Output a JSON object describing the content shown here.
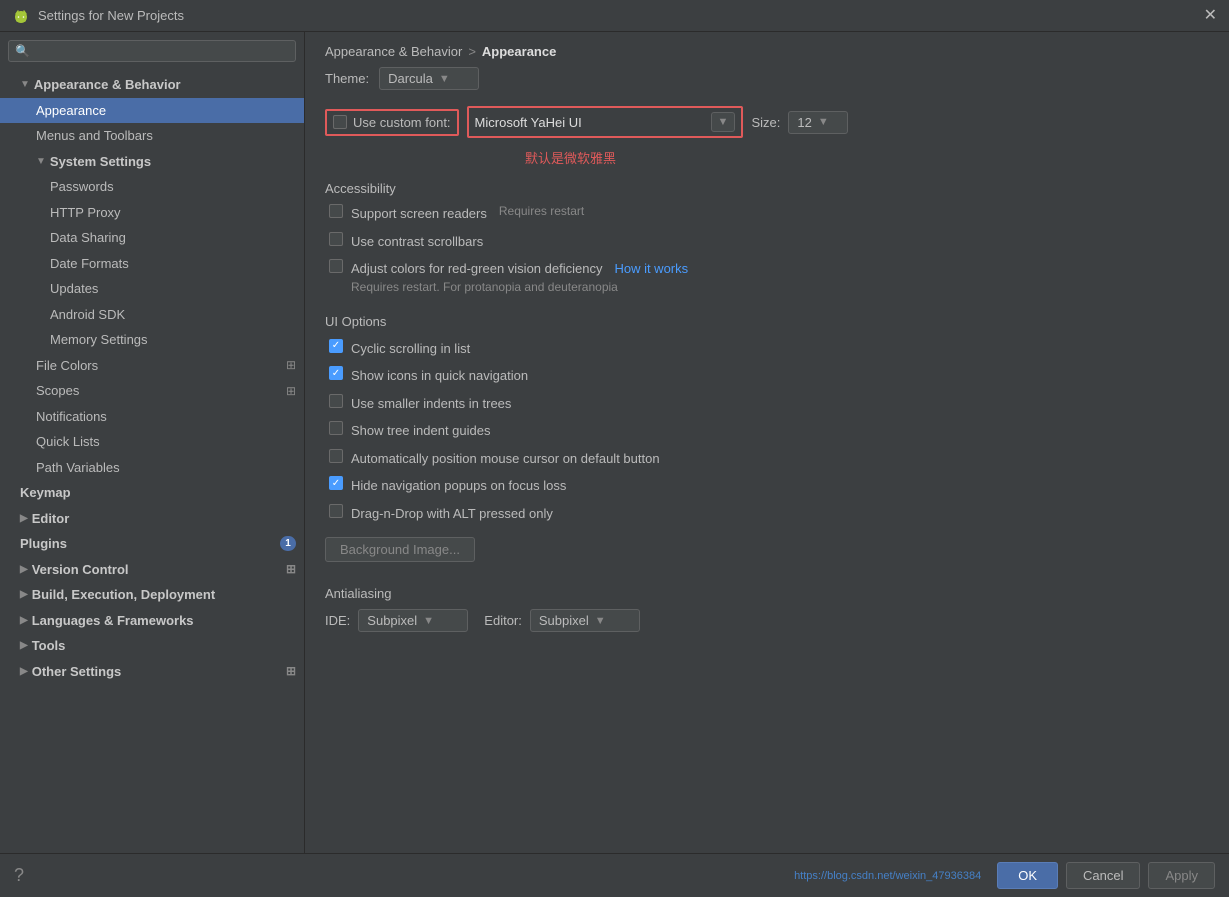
{
  "titleBar": {
    "title": "Settings for New Projects",
    "closeLabel": "✕"
  },
  "search": {
    "placeholder": ""
  },
  "sidebar": {
    "items": [
      {
        "id": "appearance-behavior",
        "label": "Appearance & Behavior",
        "level": "parent",
        "expanded": true,
        "indent": "level1"
      },
      {
        "id": "appearance",
        "label": "Appearance",
        "level": "child",
        "selected": true,
        "indent": "level2"
      },
      {
        "id": "menus-toolbars",
        "label": "Menus and Toolbars",
        "level": "child",
        "indent": "level2"
      },
      {
        "id": "system-settings",
        "label": "System Settings",
        "level": "parent-child",
        "expanded": true,
        "indent": "level2"
      },
      {
        "id": "passwords",
        "label": "Passwords",
        "level": "child",
        "indent": "level3"
      },
      {
        "id": "http-proxy",
        "label": "HTTP Proxy",
        "level": "child",
        "indent": "level3"
      },
      {
        "id": "data-sharing",
        "label": "Data Sharing",
        "level": "child",
        "indent": "level3"
      },
      {
        "id": "date-formats",
        "label": "Date Formats",
        "level": "child",
        "indent": "level3"
      },
      {
        "id": "updates",
        "label": "Updates",
        "level": "child",
        "indent": "level3"
      },
      {
        "id": "android-sdk",
        "label": "Android SDK",
        "level": "child",
        "indent": "level3"
      },
      {
        "id": "memory-settings",
        "label": "Memory Settings",
        "level": "child",
        "indent": "level3"
      },
      {
        "id": "file-colors",
        "label": "File Colors",
        "level": "parent-child",
        "indent": "level2",
        "hasIcon": true
      },
      {
        "id": "scopes",
        "label": "Scopes",
        "level": "parent-child",
        "indent": "level2",
        "hasIcon": true
      },
      {
        "id": "notifications",
        "label": "Notifications",
        "level": "child",
        "indent": "level2"
      },
      {
        "id": "quick-lists",
        "label": "Quick Lists",
        "level": "child",
        "indent": "level2"
      },
      {
        "id": "path-variables",
        "label": "Path Variables",
        "level": "child",
        "indent": "level2"
      },
      {
        "id": "keymap",
        "label": "Keymap",
        "level": "parent",
        "indent": "level1"
      },
      {
        "id": "editor",
        "label": "Editor",
        "level": "parent-collapsed",
        "indent": "level1"
      },
      {
        "id": "plugins",
        "label": "Plugins",
        "level": "parent",
        "indent": "level1",
        "badge": "1"
      },
      {
        "id": "version-control",
        "label": "Version Control",
        "level": "parent-collapsed",
        "indent": "level1",
        "hasIcon": true
      },
      {
        "id": "build-execution",
        "label": "Build, Execution, Deployment",
        "level": "parent-collapsed",
        "indent": "level1"
      },
      {
        "id": "languages-frameworks",
        "label": "Languages & Frameworks",
        "level": "parent-collapsed",
        "indent": "level1"
      },
      {
        "id": "tools",
        "label": "Tools",
        "level": "parent-collapsed",
        "indent": "level1"
      },
      {
        "id": "other-settings",
        "label": "Other Settings",
        "level": "parent-collapsed",
        "indent": "level1",
        "hasIcon": true
      }
    ]
  },
  "breadcrumb": {
    "parts": [
      "Appearance & Behavior",
      ">",
      "Appearance"
    ]
  },
  "content": {
    "themeLabel": "Theme:",
    "themeValue": "Darcula",
    "customFontLabel": "Use custom font:",
    "customFontValue": "Microsoft YaHei UI",
    "sizeLabel": "Size:",
    "sizeValue": "12",
    "annotation": "默认是微软雅黑",
    "accessibility": {
      "header": "Accessibility",
      "options": [
        {
          "id": "screen-readers",
          "label": "Support screen readers",
          "note": "Requires restart",
          "checked": false
        },
        {
          "id": "contrast-scrollbars",
          "label": "Use contrast scrollbars",
          "checked": false
        },
        {
          "id": "red-green",
          "label": "Adjust colors for red-green vision deficiency",
          "link": "How it works",
          "checked": false,
          "subnote": "Requires restart. For protanopia and deuteranopia"
        }
      ]
    },
    "uiOptions": {
      "header": "UI Options",
      "options": [
        {
          "id": "cyclic-scrolling",
          "label": "Cyclic scrolling in list",
          "checked": true
        },
        {
          "id": "icons-quick-nav",
          "label": "Show icons in quick navigation",
          "checked": true
        },
        {
          "id": "smaller-indents",
          "label": "Use smaller indents in trees",
          "checked": false
        },
        {
          "id": "tree-indent",
          "label": "Show tree indent guides",
          "checked": false
        },
        {
          "id": "mouse-cursor",
          "label": "Automatically position mouse cursor on default button",
          "checked": false
        },
        {
          "id": "hide-nav-popups",
          "label": "Hide navigation popups on focus loss",
          "checked": true
        },
        {
          "id": "drag-drop",
          "label": "Drag-n-Drop with ALT pressed only",
          "checked": false
        }
      ]
    },
    "backgroundImageBtn": "Background Image...",
    "antialiasing": {
      "header": "Antialiasing",
      "ideLabel": "IDE:",
      "ideValue": "Subpixel",
      "editorLabel": "Editor:",
      "editorValue": "Subpixel"
    }
  },
  "footer": {
    "helpIcon": "?",
    "okLabel": "OK",
    "cancelLabel": "Cancel",
    "applyLabel": "Apply",
    "watermark": "https://blog.csdn.net/weixin_47936384"
  }
}
